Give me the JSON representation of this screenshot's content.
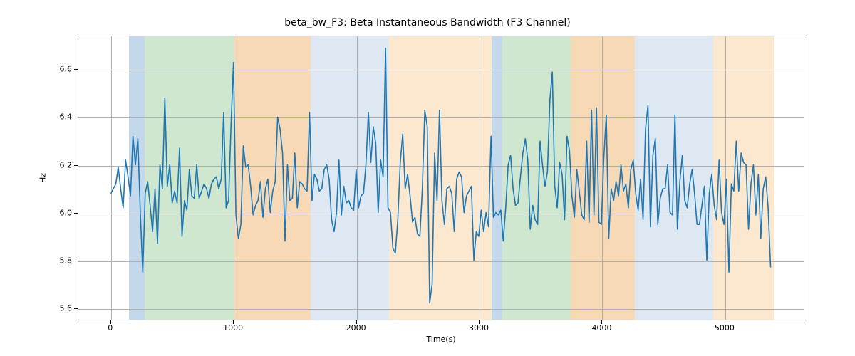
{
  "chart_data": {
    "type": "line",
    "title": "beta_bw_F3: Beta Instantaneous Bandwidth (F3 Channel)",
    "xlabel": "Time(s)",
    "ylabel": "Hz",
    "xlim": [
      -265,
      5650
    ],
    "ylim": [
      5.55,
      6.74
    ],
    "xticks": [
      0,
      1000,
      2000,
      3000,
      4000,
      5000
    ],
    "yticks": [
      5.6,
      5.8,
      6.0,
      6.2,
      6.4,
      6.6
    ],
    "background_bands": [
      {
        "x0": 145,
        "x1": 275,
        "color": "#c3d8eb"
      },
      {
        "x0": 275,
        "x1": 1000,
        "color": "#cfe7cf"
      },
      {
        "x0": 1000,
        "x1": 1625,
        "color": "#f8d9b6"
      },
      {
        "x0": 1625,
        "x1": 2265,
        "color": "#dde8f3"
      },
      {
        "x0": 2265,
        "x1": 3100,
        "color": "#fce7cf"
      },
      {
        "x0": 3100,
        "x1": 3185,
        "color": "#c3d8eb"
      },
      {
        "x0": 3185,
        "x1": 3740,
        "color": "#cfe7cf"
      },
      {
        "x0": 3740,
        "x1": 4265,
        "color": "#f8d9b6"
      },
      {
        "x0": 4265,
        "x1": 4900,
        "color": "#dde8f3"
      },
      {
        "x0": 4900,
        "x1": 5400,
        "color": "#fce7cf"
      }
    ],
    "series": [
      {
        "name": "beta_bw_F3",
        "color": "#1f77b4",
        "x_start": 0,
        "x_step": 20,
        "y": [
          6.08,
          6.1,
          6.12,
          6.19,
          6.1,
          6.02,
          6.22,
          6.15,
          6.07,
          6.32,
          6.2,
          6.31,
          6.0,
          5.75,
          6.08,
          6.13,
          6.03,
          5.92,
          6.1,
          5.87,
          6.2,
          6.1,
          6.48,
          6.11,
          6.2,
          6.04,
          6.09,
          6.04,
          6.27,
          5.9,
          6.05,
          6.01,
          6.18,
          6.07,
          6.06,
          6.2,
          6.06,
          6.09,
          6.12,
          6.1,
          6.06,
          6.12,
          6.14,
          6.15,
          6.1,
          6.14,
          6.42,
          6.02,
          6.05,
          6.37,
          6.63,
          5.99,
          5.89,
          5.95,
          6.28,
          6.19,
          6.2,
          6.11,
          5.99,
          6.03,
          6.05,
          6.13,
          5.98,
          6.1,
          6.14,
          6.0,
          6.09,
          6.13,
          6.4,
          6.35,
          6.25,
          5.88,
          6.2,
          6.05,
          6.06,
          6.25,
          6.02,
          6.13,
          6.12,
          6.1,
          6.09,
          6.42,
          6.05,
          6.16,
          6.14,
          6.09,
          6.1,
          6.18,
          6.2,
          6.14,
          5.97,
          5.92,
          6.0,
          6.22,
          5.99,
          6.11,
          6.04,
          6.05,
          6.02,
          6.01,
          6.18,
          6.02,
          6.07,
          6.08,
          6.2,
          6.42,
          6.21,
          6.36,
          6.29,
          6.0,
          6.22,
          6.15,
          6.69,
          6.02,
          6.0,
          5.85,
          5.83,
          5.97,
          6.21,
          6.33,
          6.1,
          6.16,
          6.07,
          5.96,
          5.98,
          5.91,
          5.9,
          6.1,
          6.43,
          6.36,
          5.62,
          5.7,
          6.25,
          6.05,
          6.43,
          6.05,
          5.95,
          6.1,
          6.11,
          6.08,
          5.92,
          6.14,
          6.17,
          6.15,
          6.0,
          6.07,
          6.09,
          6.11,
          5.8,
          5.92,
          5.9,
          6.01,
          5.92,
          6.0,
          5.94,
          6.32,
          5.98,
          6.0,
          5.99,
          6.01,
          5.88,
          6.02,
          6.2,
          6.24,
          6.1,
          6.03,
          6.04,
          6.15,
          6.25,
          6.31,
          6.22,
          5.93,
          6.03,
          5.97,
          5.95,
          6.3,
          6.2,
          6.11,
          6.17,
          6.47,
          6.59,
          6.11,
          6.02,
          6.21,
          6.16,
          5.97,
          6.32,
          6.26,
          6.07,
          5.98,
          6.18,
          6.09,
          5.99,
          5.97,
          6.3,
          5.96,
          6.43,
          5.99,
          6.44,
          5.96,
          5.95,
          6.23,
          6.41,
          5.89,
          6.1,
          6.05,
          6.13,
          6.07,
          6.2,
          6.09,
          6.12,
          6.02,
          6.18,
          6.22,
          6.08,
          6.01,
          6.14,
          5.97,
          6.35,
          6.45,
          5.94,
          6.24,
          6.31,
          5.95,
          6.06,
          6.1,
          6.1,
          6.2,
          6.0,
          5.99,
          6.41,
          5.93,
          6.13,
          6.24,
          6.05,
          6.02,
          6.12,
          6.18,
          6.08,
          5.95,
          5.95,
          6.03,
          6.11,
          5.8,
          6.08,
          6.16,
          6.03,
          5.97,
          6.22,
          6.0,
          5.95,
          6.14,
          5.75,
          6.12,
          6.09,
          6.3,
          6.09,
          6.25,
          6.21,
          6.2,
          5.93,
          6.12,
          6.2,
          5.99,
          6.16,
          5.89,
          6.1,
          6.15,
          6.02,
          5.77
        ]
      }
    ]
  }
}
